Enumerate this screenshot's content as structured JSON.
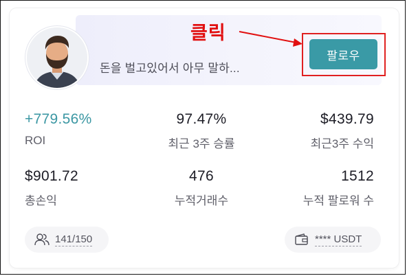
{
  "annotation": {
    "click_label": "클릭"
  },
  "profile": {
    "bio": "돈을 벌고있어서 아무 말하...",
    "follow_label": "팔로우"
  },
  "stats": [
    {
      "value": "+779.56%",
      "label": "ROI",
      "accent": true
    },
    {
      "value": "97.47%",
      "label": "최근 3주 승률"
    },
    {
      "value": "$439.79",
      "label": "최근3주 수익"
    },
    {
      "value": "$901.72",
      "label": "총손익"
    },
    {
      "value": "476",
      "label": "누적거래수"
    },
    {
      "value": "1512",
      "label": "누적 팔로워 수"
    }
  ],
  "footer": {
    "copiers": "141/150",
    "balance": "**** USDT"
  },
  "colors": {
    "accent": "#3b97a3",
    "button": "#3a9aa6",
    "annotation": "#e11010"
  },
  "icons": {
    "copiers": "people-icon",
    "balance": "wallet-icon"
  }
}
